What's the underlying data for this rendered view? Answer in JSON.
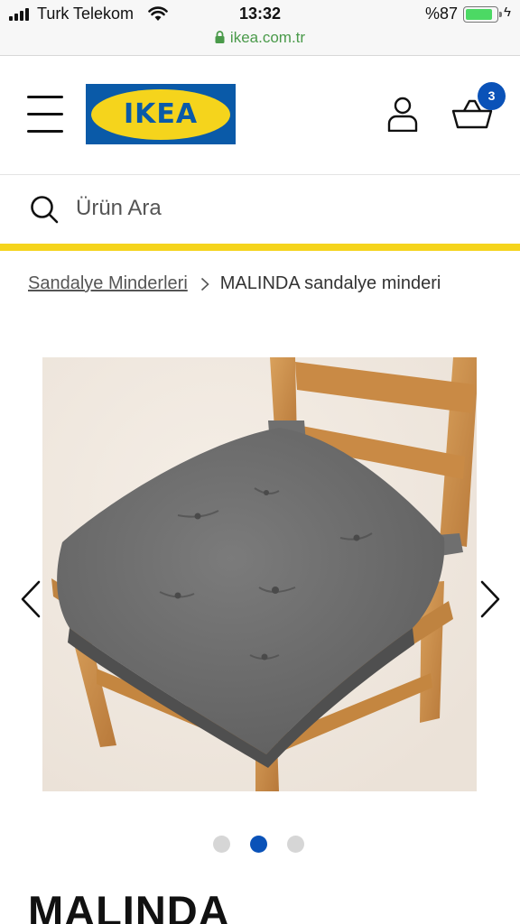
{
  "status_bar": {
    "carrier": "Turk Telekom",
    "time": "13:32",
    "battery_text": "%87",
    "battery_level": 0.87,
    "charging_symbol": "ϟ",
    "url": "ikea.com.tr",
    "signal_icon": "cellular-signal-icon",
    "wifi_icon": "wifi-icon",
    "lock_icon": "lock-icon"
  },
  "header": {
    "menu_icon": "hamburger-menu-icon",
    "logo_text": "IKEA",
    "user_icon": "user-account-icon",
    "cart_icon": "shopping-basket-icon",
    "cart_count": "3"
  },
  "search": {
    "placeholder": "Ürün Ara",
    "icon": "search-icon"
  },
  "breadcrumb": {
    "parent": "Sandalye Minderleri",
    "separator_icon": "chevron-right-icon",
    "current": "MALINDA sandalye minderi"
  },
  "gallery": {
    "current_index": 2,
    "total": 3,
    "prev_icon": "chevron-left-icon",
    "next_icon": "chevron-right-icon"
  },
  "product": {
    "title": "MALINDA"
  },
  "colors": {
    "ikea_blue": "#0a5aa8",
    "ikea_yellow": "#f5d41c",
    "badge_blue": "#0a52b8",
    "url_green": "#4a9a4a"
  }
}
